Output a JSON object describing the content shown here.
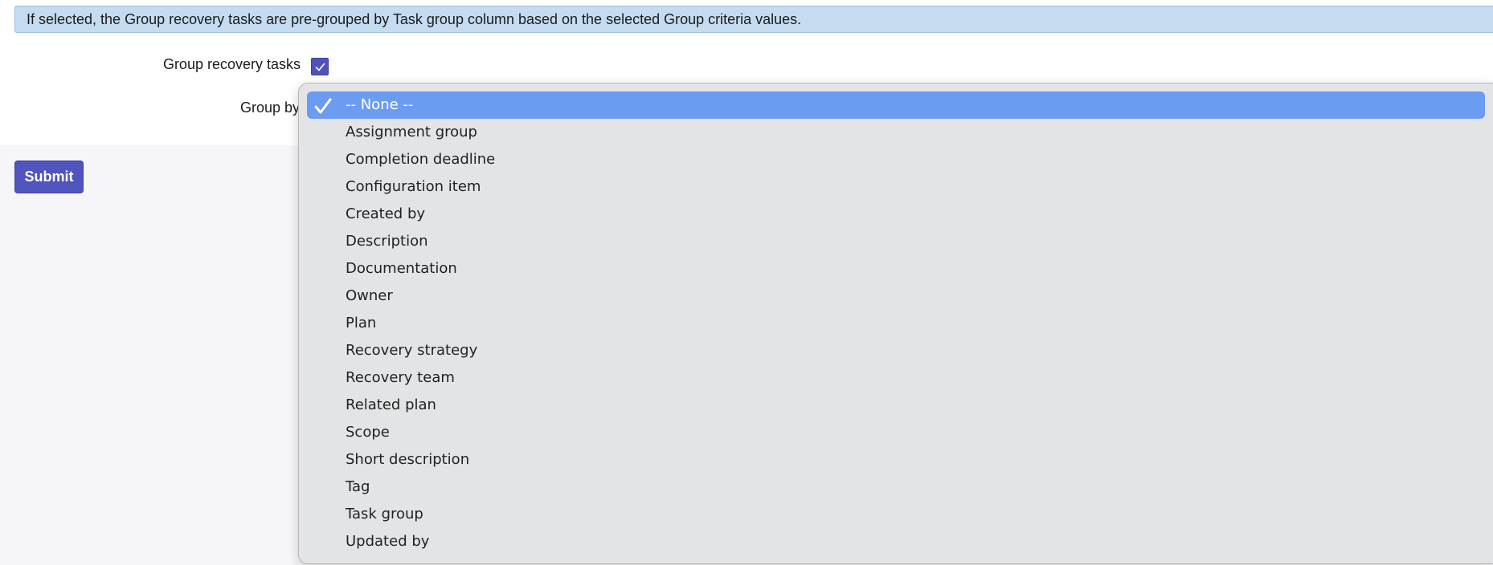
{
  "info_banner": {
    "text": "If selected, the Group recovery tasks are pre-grouped by Task group column based on the selected Group criteria values."
  },
  "form": {
    "group_tasks_label": "Group recovery tasks",
    "group_tasks_checked": true,
    "group_by_label": "Group by",
    "submit_label": "Submit"
  },
  "dropdown": {
    "selected_index": 0,
    "options": [
      "-- None --",
      "Assignment group",
      "Completion deadline",
      "Configuration item",
      "Created by",
      "Description",
      "Documentation",
      "Owner",
      "Plan",
      "Recovery strategy",
      "Recovery team",
      "Related plan",
      "Scope",
      "Short description",
      "Tag",
      "Task group",
      "Updated by"
    ]
  },
  "colors": {
    "banner_bg": "#c5dbf0",
    "accent": "#5054be",
    "highlight": "#6b9cf2",
    "dropdown_bg": "#e3e4e6"
  },
  "icons": {
    "checkbox": "checkmark-icon",
    "selected_option": "check-icon"
  }
}
